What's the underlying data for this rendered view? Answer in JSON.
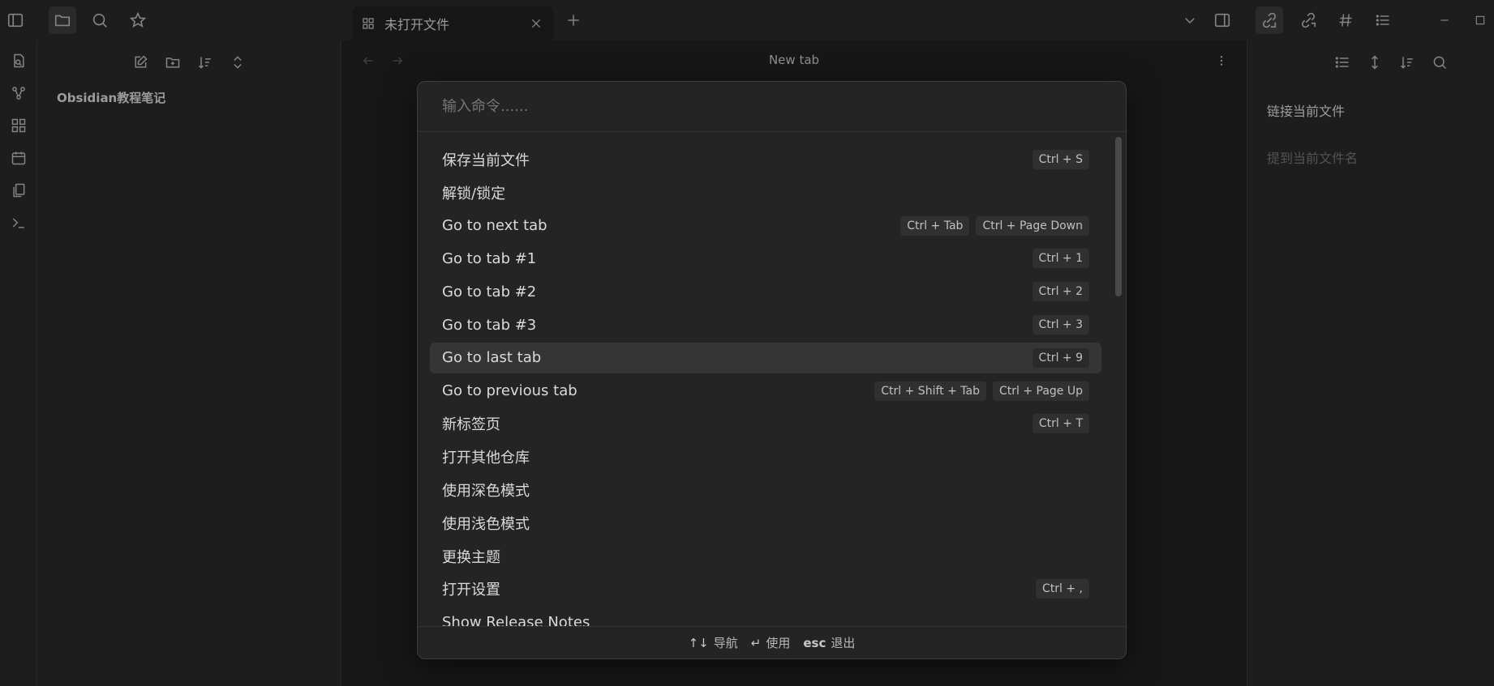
{
  "tab": {
    "title": "未打开文件",
    "icon": "grid-icon"
  },
  "main": {
    "title": "New tab"
  },
  "left_sidebar": {
    "vault_name": "Obsidian教程笔记"
  },
  "right_sidebar": {
    "linked_title": "链接当前文件",
    "mentions_placeholder": "提到当前文件名"
  },
  "palette": {
    "placeholder": "输入命令......",
    "commands": [
      {
        "label": "保存当前文件",
        "hotkeys": [
          "Ctrl + S"
        ]
      },
      {
        "label": "解锁/锁定",
        "hotkeys": []
      },
      {
        "label": "Go to next tab",
        "hotkeys": [
          "Ctrl + Tab",
          "Ctrl + Page Down"
        ]
      },
      {
        "label": "Go to tab #1",
        "hotkeys": [
          "Ctrl + 1"
        ]
      },
      {
        "label": "Go to tab #2",
        "hotkeys": [
          "Ctrl + 2"
        ]
      },
      {
        "label": "Go to tab #3",
        "hotkeys": [
          "Ctrl + 3"
        ]
      },
      {
        "label": "Go to last tab",
        "hotkeys": [
          "Ctrl + 9"
        ],
        "selected": true
      },
      {
        "label": "Go to previous tab",
        "hotkeys": [
          "Ctrl + Shift + Tab",
          "Ctrl + Page Up"
        ]
      },
      {
        "label": "新标签页",
        "hotkeys": [
          "Ctrl + T"
        ]
      },
      {
        "label": "打开其他仓库",
        "hotkeys": []
      },
      {
        "label": "使用深色模式",
        "hotkeys": []
      },
      {
        "label": "使用浅色模式",
        "hotkeys": []
      },
      {
        "label": "更换主题",
        "hotkeys": []
      },
      {
        "label": "打开设置",
        "hotkeys": [
          "Ctrl + ,"
        ]
      },
      {
        "label": "Show Release Notes",
        "hotkeys": []
      }
    ],
    "footer": {
      "navigate_key": "↑↓",
      "navigate_label": "导航",
      "use_key": "↵",
      "use_label": "使用",
      "esc_key": "esc",
      "esc_label": "退出"
    }
  },
  "colors": {
    "background": "#1e1e1e",
    "sidebar": "#262626",
    "palette": "#242424",
    "selected": "#353535"
  }
}
